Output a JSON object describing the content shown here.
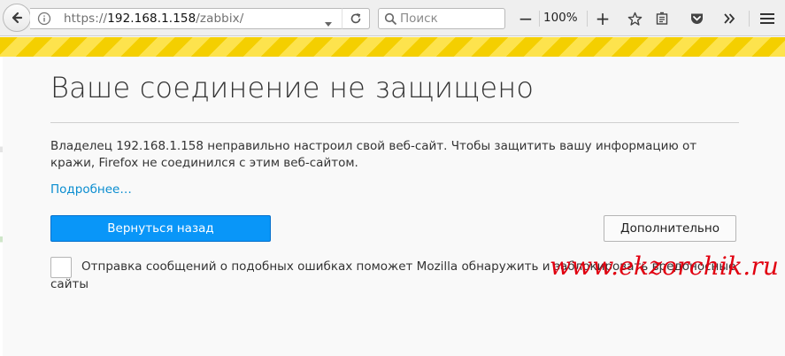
{
  "browser": {
    "url_scheme": "https://",
    "url_host": "192.168.1.158",
    "url_path": "/zabbix/",
    "search_placeholder": "Поиск",
    "zoom_level": "100%",
    "zoom_minus": "−",
    "zoom_plus": "+"
  },
  "icons": {
    "back": "back-arrow-icon",
    "info": "info-icon",
    "dropdown": "chevron-down-icon",
    "reload": "reload-icon",
    "search": "search-icon",
    "bookmark": "star-icon",
    "reader": "reading-list-icon",
    "pocket": "pocket-icon",
    "overflow": "double-chevron-right-icon",
    "menu": "hamburger-menu-icon"
  },
  "page": {
    "title": "Ваше соединение не защищено",
    "description": "Владелец 192.168.1.158 неправильно настроил свой веб-сайт. Чтобы защитить вашу информацию от кражи, Firefox не соединился с этим веб-сайтом.",
    "more_link": "Подробнее…",
    "back_button": "Вернуться назад",
    "advanced_button": "Дополнительно",
    "report_text": "Отправка сообщений о подобных ошибках поможет Mozilla обнаружить и заблокировать вредоносные сайты"
  },
  "watermark": "www.ekzorchik.ru",
  "colors": {
    "stripe_yellow": "#f4cf00",
    "primary_blue": "#0996f8",
    "link_blue": "#0a8dd0",
    "watermark_red": "#e10010"
  }
}
